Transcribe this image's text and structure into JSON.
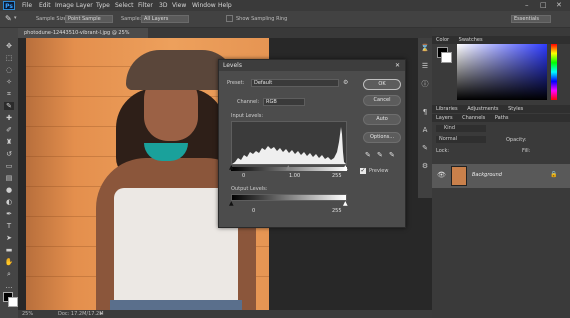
{
  "menu": {
    "logo": "Ps",
    "items": [
      "File",
      "Edit",
      "Image",
      "Layer",
      "Type",
      "Select",
      "Filter",
      "3D",
      "View",
      "Window",
      "Help"
    ]
  },
  "options": {
    "sample_size_label": "Sample Size:",
    "sample_size_value": "Point Sample",
    "sample_label": "Sample:",
    "sample_value": "All Layers",
    "show_ring_label": "Show Sampling Ring",
    "workspace": "Essentials"
  },
  "document": {
    "tab_title": "photodune-12443510-vibrant-l.jpg @ 25% (RGB/8)",
    "zoom": "25%",
    "doc_info": "Doc: 17.2M/17.2M"
  },
  "levels": {
    "title": "Levels",
    "preset_label": "Preset:",
    "preset_value": "Default",
    "channel_label": "Channel:",
    "channel_value": "RGB",
    "input_label": "Input Levels:",
    "input_black": "0",
    "input_mid": "1.00",
    "input_white": "255",
    "output_label": "Output Levels:",
    "output_black": "0",
    "output_white": "255",
    "buttons": {
      "ok": "OK",
      "cancel": "Cancel",
      "auto": "Auto",
      "options": "Options..."
    },
    "preview_label": "Preview",
    "preview_checked": true
  },
  "panels": {
    "color_tabs": [
      "Color",
      "Swatches"
    ],
    "lib_tabs": [
      "Libraries",
      "Adjustments",
      "Styles"
    ],
    "layer_tabs": [
      "Layers",
      "Channels",
      "Paths"
    ],
    "kind_label": "Kind",
    "blend_mode": "Normal",
    "opacity_label": "Opacity:",
    "fill_label": "Fill:",
    "lock_label": "Lock:",
    "layer_name": "Background"
  },
  "colors": {
    "accent_blue": "#2d8ad6",
    "dialog_bg": "#4c4c4c",
    "chrome_bg": "#3a3a3a"
  }
}
